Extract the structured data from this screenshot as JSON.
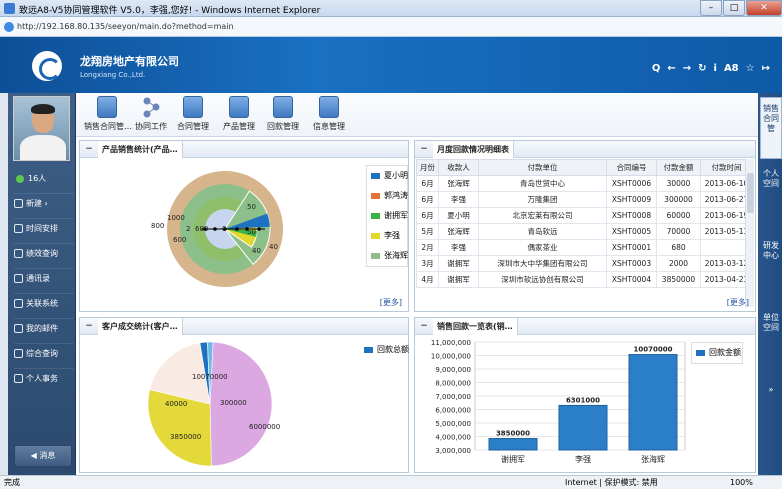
{
  "window": {
    "title": "致远A8-V5协同管理软件 V5.0，李强,您好! - Windows Internet Explorer",
    "url": "http://192.168.80.135/seeyon/main.do?method=main"
  },
  "company": {
    "name": "龙翔房地产有限公司",
    "name_en": "Longxiang Co.,Ltd."
  },
  "header_tools": [
    "Q",
    "←",
    "→",
    "↻",
    "i",
    "A8",
    "☆",
    "↦"
  ],
  "user": {
    "online_count": "16人"
  },
  "nav": {
    "items": [
      {
        "label": "新建 ›"
      },
      {
        "label": "时间安排"
      },
      {
        "label": "绩效查询"
      },
      {
        "label": "通讯录"
      },
      {
        "label": "关联系统"
      },
      {
        "label": "我的邮件"
      },
      {
        "label": "综合查询"
      },
      {
        "label": "个人事务"
      }
    ],
    "message": "消息"
  },
  "toolbar": {
    "items": [
      {
        "label": "销售合同管…"
      },
      {
        "label": "协同工作"
      },
      {
        "label": "合同管理"
      },
      {
        "label": "产品管理"
      },
      {
        "label": "回款管理"
      },
      {
        "label": "信息管理"
      }
    ]
  },
  "panels": {
    "product": {
      "title": "产品销售统计(产品…",
      "more": "[更多]",
      "legend": [
        {
          "name": "夏小明",
          "color": "#1f72c0"
        },
        {
          "name": "郭鸿涛",
          "color": "#e8703a"
        },
        {
          "name": "谢拥军",
          "color": "#3ab34a"
        },
        {
          "name": "李强",
          "color": "#e3d82a"
        },
        {
          "name": "张海辉",
          "color": "#8dbf8a"
        }
      ]
    },
    "monthly": {
      "title": "月度回款情况明细表",
      "more": "[更多]",
      "columns": [
        "月份",
        "收款人",
        "付款单位",
        "合同编号",
        "付款金额",
        "付款时间"
      ],
      "rows": [
        [
          "6月",
          "张海辉",
          "青岛世贸中心",
          "XSHT0006",
          "30000",
          "2013-06-10"
        ],
        [
          "6月",
          "李强",
          "万隆集团",
          "XSHT0009",
          "300000",
          "2013-06-27"
        ],
        [
          "6月",
          "夏小明",
          "北京宏莱有限公司",
          "XSHT0008",
          "60000",
          "2013-06-19"
        ],
        [
          "5月",
          "张海辉",
          "青岛软远",
          "XSHT0005",
          "70000",
          "2013-05-13"
        ],
        [
          "2月",
          "李强",
          "偶家茶业",
          "XSHT0001",
          "680",
          ""
        ],
        [
          "3月",
          "谢拥军",
          "深圳市大中华集团有限公司",
          "XSHT0003",
          "2000",
          "2013-03-12"
        ],
        [
          "4月",
          "谢拥军",
          "深圳市软远协创有限公司",
          "XSHT0004",
          "3850000",
          "2013-04-23"
        ]
      ]
    },
    "customer": {
      "title": "客户成交统计(客户…",
      "legend": "回款总额"
    },
    "sales": {
      "title": "销售回款一览表(销…",
      "legend": "回款金额"
    }
  },
  "chart_data": [
    {
      "type": "pie",
      "title": "",
      "variant": "concentric-rings",
      "series": [
        {
          "name": "夏小明",
          "color": "#1f72c0"
        },
        {
          "name": "郭鸿涛",
          "color": "#e8703a"
        },
        {
          "name": "谢拥军",
          "color": "#3ab34a"
        },
        {
          "name": "李强",
          "color": "#e3d82a"
        },
        {
          "name": "张海辉",
          "color": "#8dbf8a"
        }
      ],
      "labels": [
        "1000",
        "800",
        "600",
        "50",
        "50",
        "40",
        "40",
        "2",
        "600",
        "0"
      ]
    },
    {
      "type": "pie",
      "title": "",
      "values": [
        10070000,
        6000000,
        3850000,
        400000,
        300000
      ],
      "labels": [
        "10070000",
        "6000000",
        "3850000",
        "40000",
        "300000"
      ],
      "colors": [
        "#dba8e2",
        "#e4d93a",
        "#f9ebe3",
        "#1f72c0",
        "#6fb8e8"
      ],
      "legend": "回款总额"
    },
    {
      "type": "bar",
      "title": "",
      "categories": [
        "谢拥军",
        "李强",
        "张海辉"
      ],
      "values": [
        3850000,
        6301000,
        10070000
      ],
      "labels": [
        "3850000",
        "6301000",
        "10070000"
      ],
      "ylim": [
        3000000,
        11000000
      ],
      "yticks": [
        "3,000,000",
        "4,000,000",
        "5,000,000",
        "6,000,000",
        "7,000,000",
        "8,000,000",
        "9,000,000",
        "10,000,000",
        "11,000,000"
      ],
      "legend": "回款金额",
      "color": "#2b7fc8"
    }
  ],
  "right_tabs": [
    "销售合同管",
    "个人空间",
    "研发中心",
    "单位空间",
    "»"
  ],
  "status": {
    "left": "完成",
    "zone": "Internet | 保护模式: 禁用",
    "zoom": "100%"
  }
}
